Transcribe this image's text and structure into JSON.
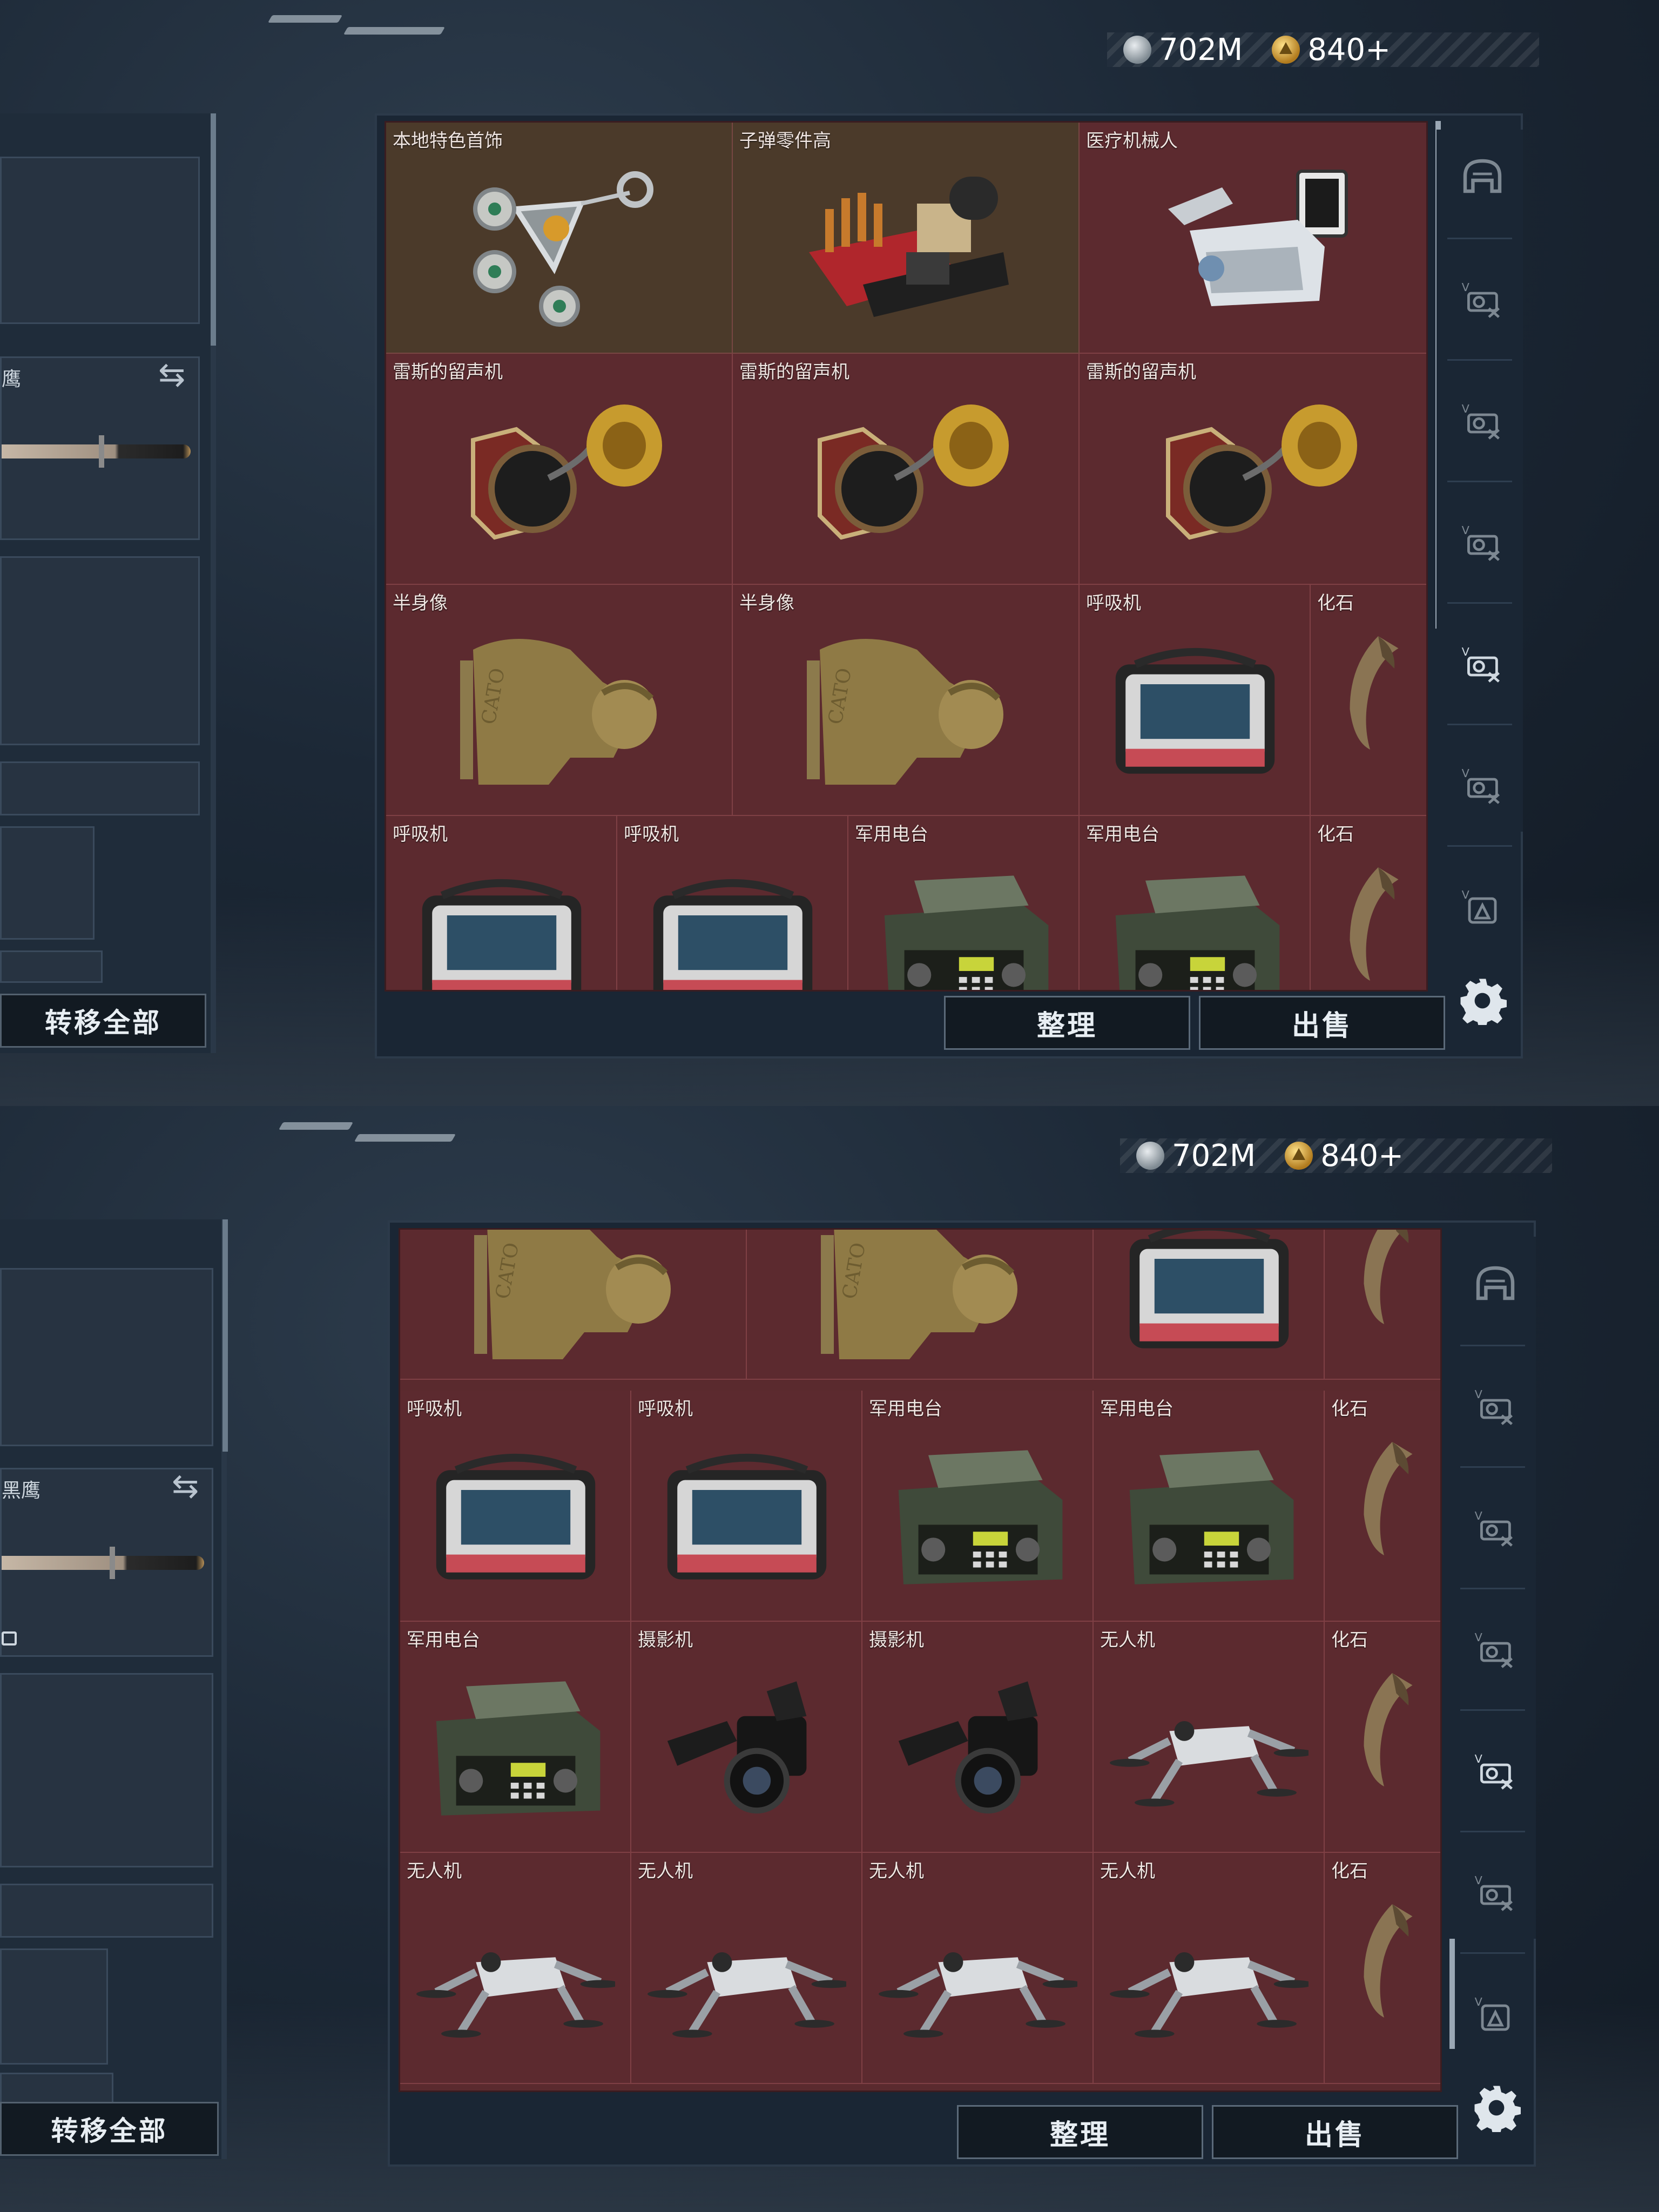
{
  "screens": [
    {
      "currency": {
        "silver_value": "702M",
        "gold_value": "840+"
      },
      "left_panel": {
        "weapon_name": "鹰",
        "transfer_all_label": "转移全部"
      },
      "stash": {
        "cells": [
          {
            "label": "本地特色首饰"
          },
          {
            "label": "子弹零件高"
          },
          {
            "label": "医疗机械人"
          },
          {
            "label": "雷斯的留声机"
          },
          {
            "label": "雷斯的留声机"
          },
          {
            "label": "雷斯的留声机"
          },
          {
            "label": "半身像"
          },
          {
            "label": "半身像"
          },
          {
            "label": "呼吸机"
          },
          {
            "label": "化石"
          },
          {
            "label": "呼吸机"
          },
          {
            "label": "呼吸机"
          },
          {
            "label": "军用电台"
          },
          {
            "label": "军用电台"
          },
          {
            "label": "化石"
          }
        ],
        "sort_label": "整理",
        "sell_label": "出售"
      }
    },
    {
      "currency": {
        "silver_value": "702M",
        "gold_value": "840+"
      },
      "left_panel": {
        "weapon_name": "黑鹰",
        "transfer_all_label": "转移全部"
      },
      "stash": {
        "cells": [
          {
            "label": ""
          },
          {
            "label": ""
          },
          {
            "label": ""
          },
          {
            "label": ""
          },
          {
            "label": "呼吸机"
          },
          {
            "label": "呼吸机"
          },
          {
            "label": "军用电台"
          },
          {
            "label": "军用电台"
          },
          {
            "label": "化石"
          },
          {
            "label": "军用电台"
          },
          {
            "label": "摄影机"
          },
          {
            "label": "摄影机"
          },
          {
            "label": "无人机"
          },
          {
            "label": "化石"
          },
          {
            "label": "无人机"
          },
          {
            "label": "无人机"
          },
          {
            "label": "无人机"
          },
          {
            "label": "无人机"
          },
          {
            "label": "化石"
          }
        ],
        "sort_label": "整理",
        "sell_label": "出售"
      }
    }
  ],
  "icons": {
    "currency": [
      "silver-coin-icon",
      "gold-coin-icon"
    ],
    "side_tabs": [
      "helmet-icon",
      "vehicle-icon",
      "vehicle-icon",
      "vehicle-icon",
      "vehicle-icon-active",
      "vehicle-icon",
      "backpack-icon"
    ],
    "settings": "gear-icon"
  }
}
